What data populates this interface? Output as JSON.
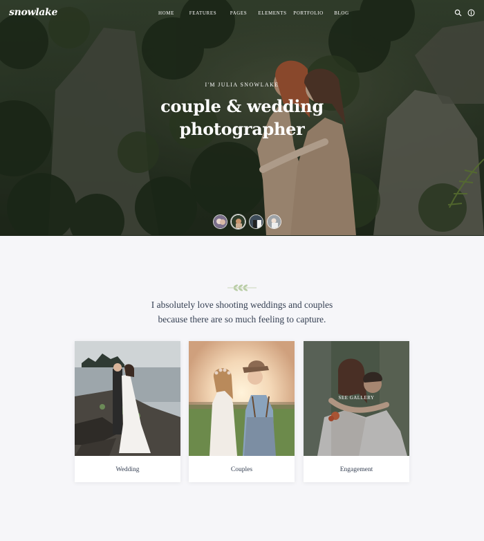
{
  "brand": {
    "logo": "snowlake"
  },
  "nav": {
    "links": [
      "Home",
      "Features",
      "Pages",
      "Elements",
      "Portfolio",
      "Blog"
    ]
  },
  "hero": {
    "eyebrow": "I'm Julia Snowlake",
    "headline": "couple & wedding photographer",
    "slides": [
      {
        "name": "slide-1"
      },
      {
        "name": "slide-2"
      },
      {
        "name": "slide-3"
      },
      {
        "name": "slide-4"
      }
    ]
  },
  "intro": {
    "line1": "I absolutely love shooting weddings and couples",
    "line2": "because there are so much feeling to capture."
  },
  "cards": [
    {
      "title": "Wedding"
    },
    {
      "title": "Couples"
    },
    {
      "title": "Engagement",
      "hover_label": "See Gallery"
    }
  ]
}
